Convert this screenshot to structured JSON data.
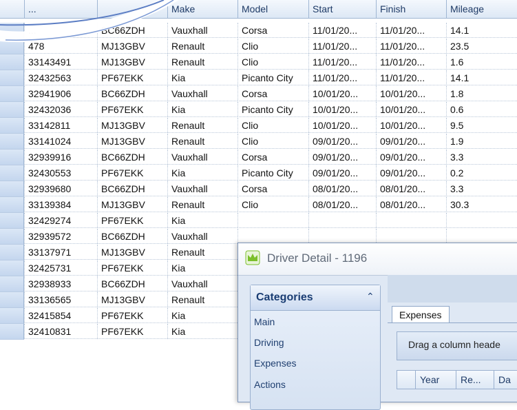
{
  "grid": {
    "columns": [
      "...",
      "Make",
      "Model",
      "Start",
      "Finish",
      "Mileage",
      ""
    ],
    "rows": [
      [
        "...",
        "BC66ZDH",
        "Vauxhall",
        "Corsa",
        "11/01/20...",
        "11/01/20...",
        "14.1"
      ],
      [
        "478",
        "MJ13GBV",
        "Renault",
        "Clio",
        "11/01/20...",
        "11/01/20...",
        "23.5"
      ],
      [
        "33143491",
        "MJ13GBV",
        "Renault",
        "Clio",
        "11/01/20...",
        "11/01/20...",
        "1.6"
      ],
      [
        "32432563",
        "PF67EKK",
        "Kia",
        "Picanto City",
        "11/01/20...",
        "11/01/20...",
        "14.1"
      ],
      [
        "32941906",
        "BC66ZDH",
        "Vauxhall",
        "Corsa",
        "10/01/20...",
        "10/01/20...",
        "1.8"
      ],
      [
        "32432036",
        "PF67EKK",
        "Kia",
        "Picanto City",
        "10/01/20...",
        "10/01/20...",
        "0.6"
      ],
      [
        "33142811",
        "MJ13GBV",
        "Renault",
        "Clio",
        "10/01/20...",
        "10/01/20...",
        "9.5"
      ],
      [
        "33141024",
        "MJ13GBV",
        "Renault",
        "Clio",
        "09/01/20...",
        "09/01/20...",
        "1.9"
      ],
      [
        "32939916",
        "BC66ZDH",
        "Vauxhall",
        "Corsa",
        "09/01/20...",
        "09/01/20...",
        "3.3"
      ],
      [
        "32430553",
        "PF67EKK",
        "Kia",
        "Picanto City",
        "09/01/20...",
        "09/01/20...",
        "0.2"
      ],
      [
        "32939680",
        "BC66ZDH",
        "Vauxhall",
        "Corsa",
        "08/01/20...",
        "08/01/20...",
        "3.3"
      ],
      [
        "33139384",
        "MJ13GBV",
        "Renault",
        "Clio",
        "08/01/20...",
        "08/01/20...",
        "30.3"
      ],
      [
        "32429274",
        "PF67EKK",
        "Kia",
        "",
        "",
        "",
        ""
      ],
      [
        "32939572",
        "BC66ZDH",
        "Vauxhall",
        "",
        "",
        "",
        ""
      ],
      [
        "33137971",
        "MJ13GBV",
        "Renault",
        "",
        "",
        "",
        ""
      ],
      [
        "32425731",
        "PF67EKK",
        "Kia",
        "",
        "",
        "",
        ""
      ],
      [
        "32938933",
        "BC66ZDH",
        "Vauxhall",
        "",
        "",
        "",
        ""
      ],
      [
        "33136565",
        "MJ13GBV",
        "Renault",
        "",
        "",
        "",
        ""
      ],
      [
        "32415854",
        "PF67EKK",
        "Kia",
        "",
        "",
        "",
        ""
      ],
      [
        "32410831",
        "PF67EKK",
        "Kia",
        "",
        "",
        "",
        ""
      ]
    ]
  },
  "dialog": {
    "title": "Driver Detail - 1196",
    "app_icon": "crown-icon",
    "categories": {
      "title": "Categories",
      "collapse_icon": "double-chevron-up-icon",
      "items": [
        "Main",
        "Driving",
        "Expenses",
        "Actions"
      ]
    },
    "tab": "Expenses",
    "group_panel_text": "Drag a column heade",
    "sub_columns": [
      "Year",
      "Re...",
      "Da"
    ]
  },
  "colors": {
    "header_bg": "#dde8f5",
    "border": "#9fb6d3",
    "accent_title": "#1a3d73",
    "crown": "#7bbf2a"
  }
}
